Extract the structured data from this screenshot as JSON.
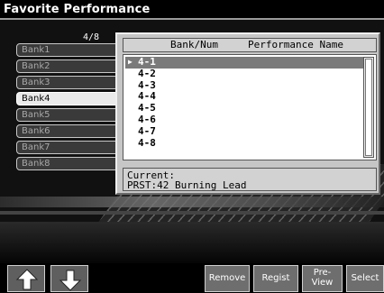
{
  "title": "Favorite Performance",
  "bank_page": "4/8",
  "banks": [
    {
      "label": "Bank1"
    },
    {
      "label": "Bank2"
    },
    {
      "label": "Bank3"
    },
    {
      "label": "Bank4"
    },
    {
      "label": "Bank5"
    },
    {
      "label": "Bank6"
    },
    {
      "label": "Bank7"
    },
    {
      "label": "Bank8"
    }
  ],
  "selected_bank": "Bank4",
  "list": {
    "header_num": "Bank/Num",
    "header_name": "Performance Name",
    "items": [
      {
        "num": "4-1",
        "name": ""
      },
      {
        "num": "4-2",
        "name": ""
      },
      {
        "num": "4-3",
        "name": ""
      },
      {
        "num": "4-4",
        "name": ""
      },
      {
        "num": "4-5",
        "name": ""
      },
      {
        "num": "4-6",
        "name": ""
      },
      {
        "num": "4-7",
        "name": ""
      },
      {
        "num": "4-8",
        "name": ""
      }
    ],
    "selected_index": 0
  },
  "current": {
    "label": "Current:",
    "value": "PRST:42 Burning Lead"
  },
  "buttons": {
    "up": "up-arrow",
    "down": "down-arrow",
    "remove": "Remove",
    "regist": "Regist",
    "preview_line1": "Pre-",
    "preview_line2": "View",
    "select": "Select"
  }
}
